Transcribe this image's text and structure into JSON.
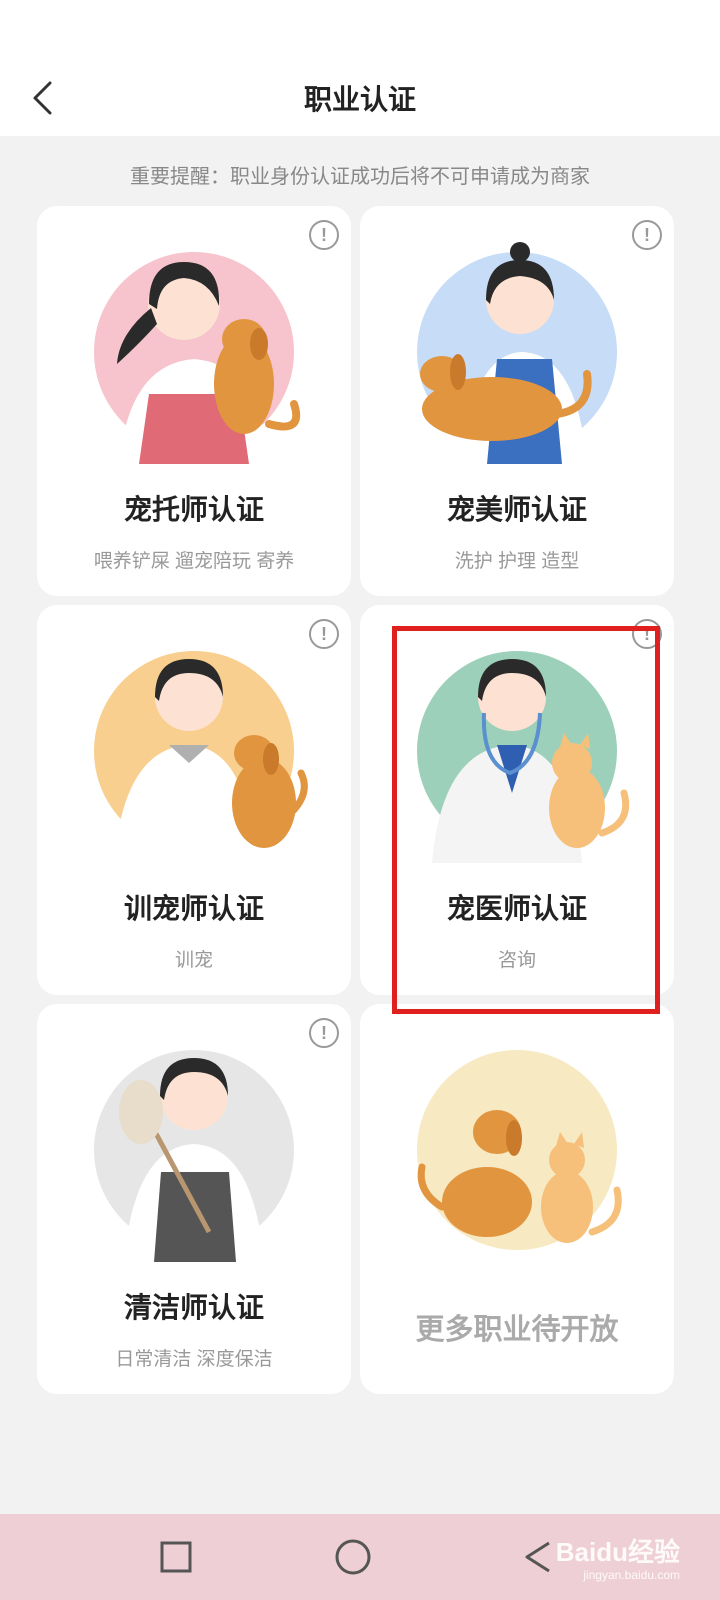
{
  "header": {
    "title": "职业认证"
  },
  "notice": "重要提醒：职业身份认证成功后将不可申请成为商家",
  "cards": [
    {
      "title": "宠托师认证",
      "subtitle": "喂养铲屎 遛宠陪玩 寄养",
      "info_icon": "!",
      "illustration": "pet-sitter-with-dog",
      "bg_color": "#f7c4cd"
    },
    {
      "title": "宠美师认证",
      "subtitle": "洗护 护理 造型",
      "info_icon": "!",
      "illustration": "groomer-with-dog",
      "bg_color": "#c7dcf7"
    },
    {
      "title": "训宠师认证",
      "subtitle": "训宠",
      "info_icon": "!",
      "illustration": "trainer-with-dog",
      "bg_color": "#f8cf8f"
    },
    {
      "title": "宠医师认证",
      "subtitle": "咨询",
      "info_icon": "!",
      "illustration": "vet-with-cat",
      "bg_color": "#9dd0ba"
    },
    {
      "title": "清洁师认证",
      "subtitle": "日常清洁 深度保洁",
      "info_icon": "!",
      "illustration": "cleaner-with-duster",
      "bg_color": "#e6e6e6"
    },
    {
      "title": "更多职业待开放",
      "illustration": "dog-and-cat",
      "bg_color": "#f7e9c2"
    }
  ],
  "watermark": {
    "text": "Baidu经验",
    "sub": "jingyan.baidu.com"
  },
  "colors": {
    "highlight": "#e0201f",
    "navbar": "#efcfd6"
  }
}
